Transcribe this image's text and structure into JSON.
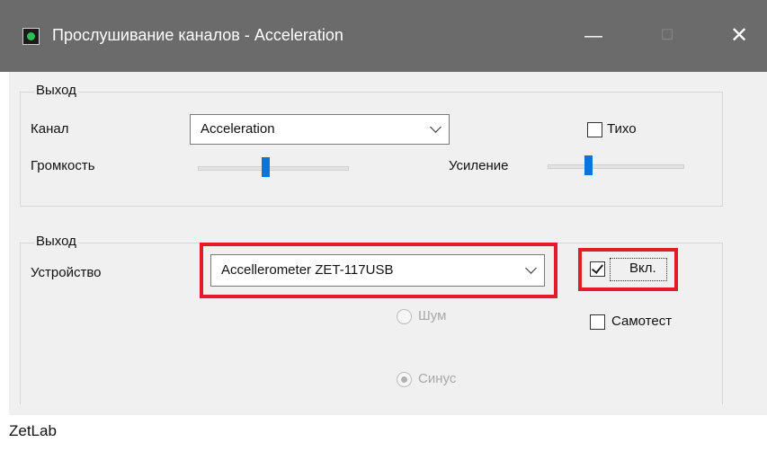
{
  "window": {
    "title": "Прослушивание каналов - Acceleration",
    "minimize": "—",
    "maximize": "☐",
    "close": "✕"
  },
  "group1": {
    "legend": "Выход",
    "channel_label": "Канал",
    "channel_value": "Acceleration",
    "quiet_label": "Тихо",
    "volume_label": "Громкость",
    "volume_value": 0.45,
    "gain_label": "Усиление",
    "gain_value": 0.3
  },
  "group2": {
    "legend": "Выход",
    "device_label": "Устройство",
    "device_value": "Accellerometer ZET-117USB",
    "enable_label": "Вкл.",
    "enable_checked": true,
    "noise_label": "Шум",
    "selftest_label": "Самотест",
    "sine_label": "Синус"
  },
  "status_text": "ZetLab",
  "colors": {
    "highlight": "#e21c2b",
    "titlebar": "#6b6b6b",
    "slider_thumb": "#0a74d8"
  }
}
